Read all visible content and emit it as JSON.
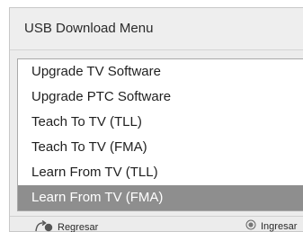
{
  "menu": {
    "title": "USB Download Menu",
    "items": [
      {
        "label": "Upgrade TV Software"
      },
      {
        "label": "Upgrade PTC Software"
      },
      {
        "label": "Teach To TV (TLL)"
      },
      {
        "label": "Teach To TV (FMA)"
      },
      {
        "label": "Learn From TV (TLL)"
      },
      {
        "label": "Learn From TV (FMA)",
        "selected": true
      }
    ]
  },
  "footer": {
    "back_label": "Regresar",
    "back_icon": "return-arrow-icon",
    "enter_label": "Ingresar",
    "enter_icon": "ok-button-icon"
  },
  "colors": {
    "selected_background": "#8e8e8e",
    "frame_background": "#ececec",
    "list_background": "#ffffff"
  }
}
